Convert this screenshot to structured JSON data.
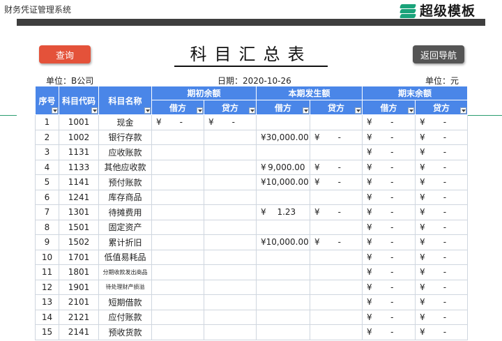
{
  "app": {
    "title": "财务凭证管理系统",
    "brand": "超级模板"
  },
  "toolbar": {
    "query_label": "查询",
    "back_label": "返回导航"
  },
  "report": {
    "title": "科目汇总表",
    "unit_company": "单位：B公司",
    "date": "日期：2020-10-26",
    "unit_currency": "单位：元"
  },
  "table": {
    "headers": {
      "seq": "序号",
      "code": "科目代码",
      "name": "科目名称",
      "opening": "期初余额",
      "current": "本期发生额",
      "closing": "期末余额",
      "debit": "借方",
      "credit": "贷方"
    },
    "currency": "¥",
    "rows": [
      {
        "seq": "1",
        "code": "1001",
        "name": "现金",
        "od": "-",
        "oc": "-",
        "cd": "",
        "cc": "",
        "ed": "-",
        "ec": "-"
      },
      {
        "seq": "2",
        "code": "1002",
        "name": "银行存款",
        "od": "",
        "oc": "",
        "cd": "30,000.00",
        "cc": "-",
        "ed": "-",
        "ec": "-"
      },
      {
        "seq": "3",
        "code": "1131",
        "name": "应收账款",
        "od": "",
        "oc": "",
        "cd": "",
        "cc": "",
        "ed": "-",
        "ec": "-"
      },
      {
        "seq": "4",
        "code": "1133",
        "name": "其他应收款",
        "od": "",
        "oc": "",
        "cd": "9,000.00",
        "cc": "-",
        "ed": "-",
        "ec": "-"
      },
      {
        "seq": "5",
        "code": "1141",
        "name": "预付账款",
        "od": "",
        "oc": "",
        "cd": "10,000.00",
        "cc": "-",
        "ed": "-",
        "ec": "-"
      },
      {
        "seq": "6",
        "code": "1241",
        "name": "库存商品",
        "od": "",
        "oc": "",
        "cd": "",
        "cc": "",
        "ed": "-",
        "ec": "-"
      },
      {
        "seq": "7",
        "code": "1301",
        "name": "待摊费用",
        "od": "",
        "oc": "",
        "cd": "1.23",
        "cc": "-",
        "ed": "-",
        "ec": "-"
      },
      {
        "seq": "8",
        "code": "1501",
        "name": "固定资产",
        "od": "",
        "oc": "",
        "cd": "",
        "cc": "",
        "ed": "-",
        "ec": "-"
      },
      {
        "seq": "9",
        "code": "1502",
        "name": "累计折旧",
        "od": "",
        "oc": "",
        "cd": "10,000.00",
        "cc": "-",
        "ed": "-",
        "ec": "-"
      },
      {
        "seq": "10",
        "code": "1701",
        "name": "低值易耗品",
        "od": "",
        "oc": "",
        "cd": "",
        "cc": "",
        "ed": "-",
        "ec": "-"
      },
      {
        "seq": "11",
        "code": "1801",
        "name": "分期收款发出商品",
        "od": "",
        "oc": "",
        "cd": "",
        "cc": "",
        "ed": "-",
        "ec": "-",
        "small": true
      },
      {
        "seq": "12",
        "code": "1901",
        "name": "待处理财产损溢",
        "od": "",
        "oc": "",
        "cd": "",
        "cc": "",
        "ed": "-",
        "ec": "-",
        "small": true
      },
      {
        "seq": "13",
        "code": "2101",
        "name": "短期借款",
        "od": "",
        "oc": "",
        "cd": "",
        "cc": "",
        "ed": "-",
        "ec": "-"
      },
      {
        "seq": "14",
        "code": "2121",
        "name": "应付账款",
        "od": "",
        "oc": "",
        "cd": "",
        "cc": "",
        "ed": "-",
        "ec": "-"
      },
      {
        "seq": "15",
        "code": "2141",
        "name": "预收货款",
        "od": "",
        "oc": "",
        "cd": "",
        "cc": "",
        "ed": "-",
        "ec": "-"
      }
    ]
  },
  "colors": {
    "header": "#4a86e8",
    "query": "#e4523a",
    "back": "#555555",
    "brand": "#1aa37a"
  }
}
